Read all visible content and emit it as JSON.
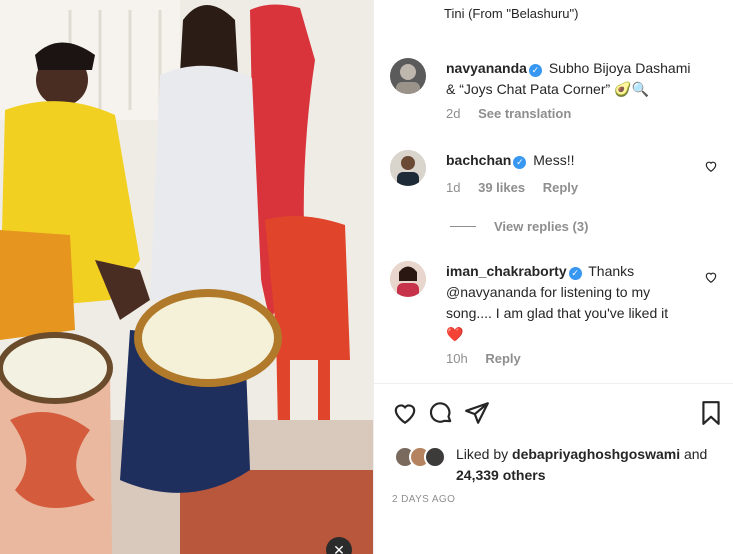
{
  "media": {
    "description_icons": [
      "close-icon"
    ]
  },
  "top_song": "Tini (From \"Belashuru\")",
  "comments": [
    {
      "username": "navyananda",
      "verified": true,
      "text": "Subho Bijoya Dashami & “Joys Chat Pata Corner” 🥑🔍",
      "time": "2d",
      "action": "See translation"
    },
    {
      "username": "bachchan",
      "verified": true,
      "text": "Mess!!",
      "time": "1d",
      "likes": "39 likes",
      "action": "Reply",
      "view_replies": "View replies (3)"
    },
    {
      "username": "iman_chakraborty",
      "verified": true,
      "text": "Thanks @navyananda for listening to my song.... I am glad that you've liked it",
      "emoji": "❤️",
      "time": "10h",
      "action": "Reply"
    }
  ],
  "liked_by": {
    "prefix": "Liked by",
    "user": "debapriyaghoshgoswami",
    "mid": "and",
    "count": "24,339 others"
  },
  "date": "2 DAYS AGO",
  "colors": {
    "verified": "#3897f0",
    "muted": "#8e8e8e",
    "heart_red": "#ed4956"
  }
}
